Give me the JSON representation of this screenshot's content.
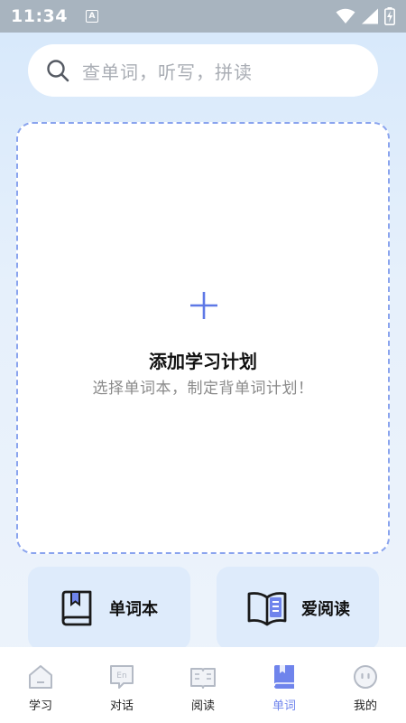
{
  "status_bar": {
    "time": "11:34",
    "notification_icon_letter": "A",
    "icons": [
      "wifi-icon",
      "signal-icon",
      "battery-charging-icon"
    ]
  },
  "search": {
    "placeholder": "查单词，听写，拼读",
    "icon": "search-icon"
  },
  "plan_card": {
    "title": "添加学习计划",
    "subtitle": "选择单词本，制定背单词计划！",
    "icon": "plus-icon"
  },
  "features": [
    {
      "label": "单词本",
      "icon": "wordbook-icon"
    },
    {
      "label": "爱阅读",
      "icon": "open-book-icon"
    }
  ],
  "bottom_nav": {
    "items": [
      {
        "label": "学习",
        "icon": "home-icon",
        "active": false
      },
      {
        "label": "对话",
        "icon": "dialogue-icon",
        "active": false
      },
      {
        "label": "阅读",
        "icon": "reading-icon",
        "active": false
      },
      {
        "label": "单词",
        "icon": "book-icon",
        "active": true
      },
      {
        "label": "我的",
        "icon": "profile-icon",
        "active": false
      }
    ]
  },
  "colors": {
    "accent": "#6f84ec",
    "dashed_border": "#8aa4ee",
    "feature_card_bg": "#deebfb",
    "status_bar_bg": "#a8b4bf"
  }
}
